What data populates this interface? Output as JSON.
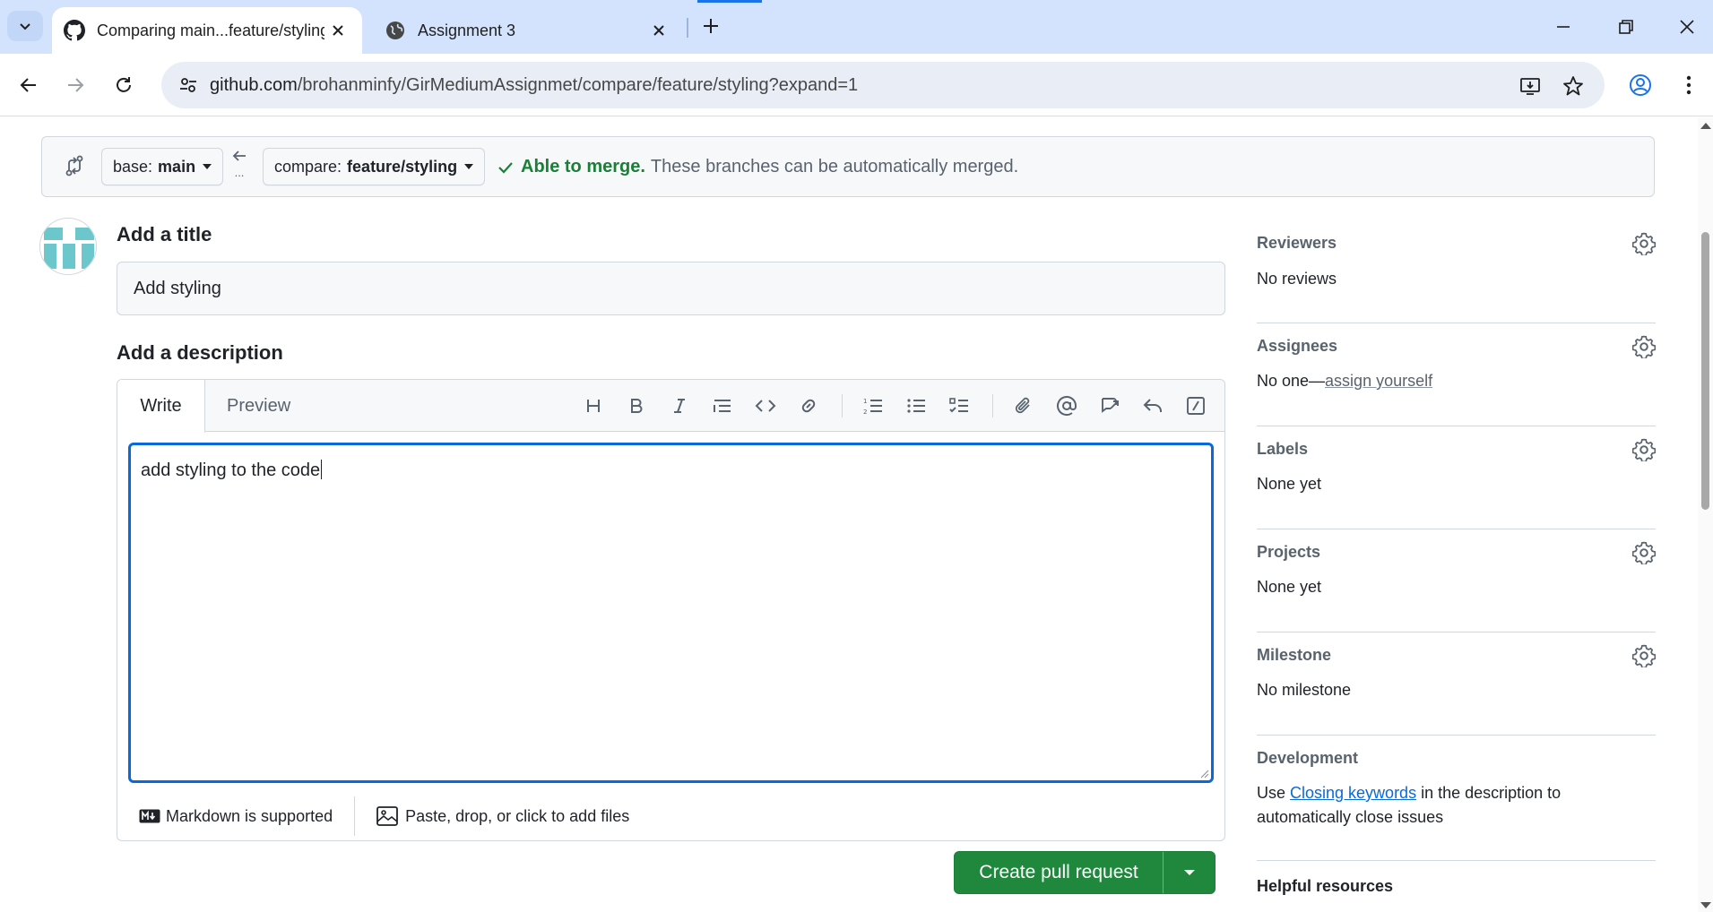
{
  "browser": {
    "tabs": [
      {
        "title": "Comparing main...feature/styling",
        "active": true,
        "icon": "github-icon"
      },
      {
        "title": "Assignment 3",
        "active": false,
        "icon": "globe-icon"
      }
    ],
    "url_host": "github.com",
    "url_path": "/brohanminfy/GirMediumAssignmet/compare/feature/styling?expand=1"
  },
  "compare": {
    "base_prefix": "base:",
    "base_branch": "main",
    "ellipsis": "...",
    "compare_prefix": "compare:",
    "compare_branch": "feature/styling",
    "merge_status": "Able to merge.",
    "merge_desc": "These branches can be automatically merged."
  },
  "form": {
    "title_label": "Add a title",
    "title_value": "Add styling",
    "description_label": "Add a description",
    "tabs": {
      "write": "Write",
      "preview": "Preview"
    },
    "description_value": "add styling to the code",
    "markdown_note": "Markdown is supported",
    "attach_note": "Paste, drop, or click to add files",
    "submit_label": "Create pull request"
  },
  "sidebar": {
    "reviewers": {
      "heading": "Reviewers",
      "value": "No reviews"
    },
    "assignees": {
      "heading": "Assignees",
      "value_prefix": "No one—",
      "value_link": "assign yourself"
    },
    "labels": {
      "heading": "Labels",
      "value": "None yet"
    },
    "projects": {
      "heading": "Projects",
      "value": "None yet"
    },
    "milestone": {
      "heading": "Milestone",
      "value": "No milestone"
    },
    "development": {
      "heading": "Development",
      "text_prefix": "Use ",
      "link": "Closing keywords",
      "text_suffix": " in the description to automatically close issues"
    },
    "helpful": {
      "heading": "Helpful resources"
    }
  },
  "colors": {
    "accent": "#0969da",
    "success": "#1a7f37",
    "primary_button": "#1f883d",
    "chrome_tabstrip": "#d3e3fd"
  }
}
